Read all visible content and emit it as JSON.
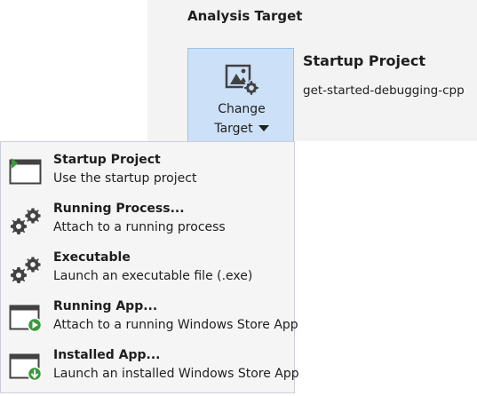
{
  "analysis_panel": {
    "title": "Analysis Target",
    "change_target": {
      "label_line1": "Change",
      "label_line2": "Target"
    },
    "startup_project": {
      "title": "Startup Project",
      "value": "get-started-debugging-cpp"
    }
  },
  "dropdown": {
    "items": [
      {
        "title": "Startup Project",
        "description": "Use the startup project",
        "icon": "startup-project-icon"
      },
      {
        "title": "Running Process...",
        "description": "Attach to a running process",
        "icon": "gears-icon"
      },
      {
        "title": "Executable",
        "description": "Launch an executable file (.exe)",
        "icon": "gears-icon"
      },
      {
        "title": "Running App...",
        "description": "Attach to a running Windows Store App",
        "icon": "running-app-icon"
      },
      {
        "title": "Installed App...",
        "description": "Launch an installed Windows Store App",
        "icon": "installed-app-icon"
      }
    ]
  },
  "colors": {
    "panel_bg": "#f3f3f3",
    "button_bg": "#cce0f7",
    "button_border": "#99c4ec",
    "dropdown_bg": "#f5f5f5",
    "accent_green": "#3a9a3a"
  }
}
